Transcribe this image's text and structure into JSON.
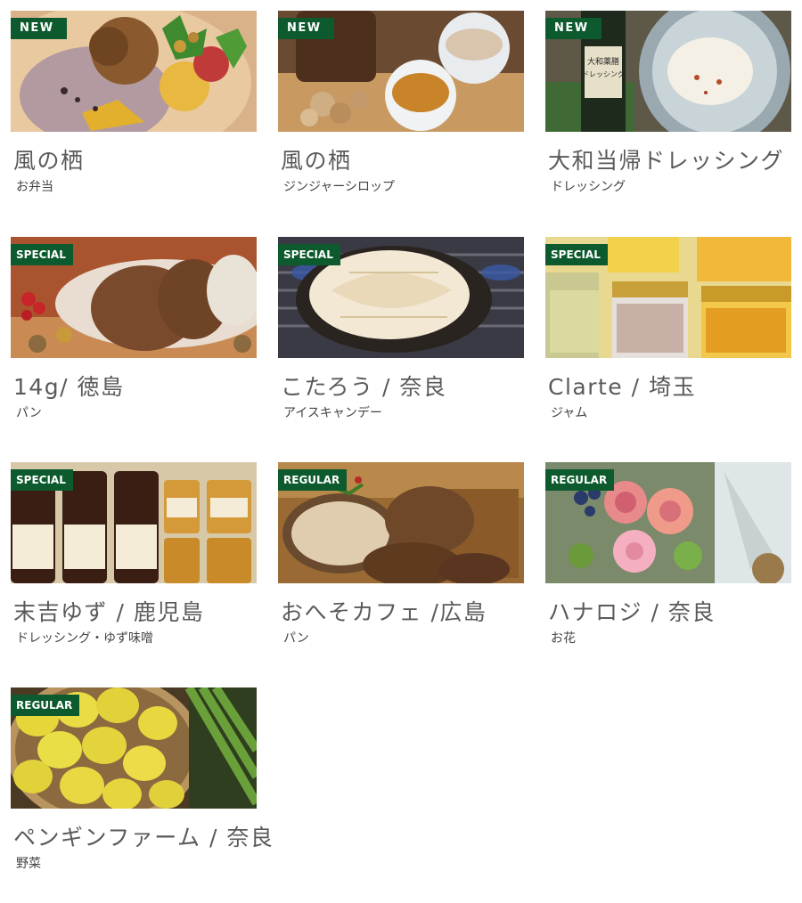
{
  "cards": [
    {
      "badge": "NEW",
      "title": "風の栖",
      "sub": "お弁当",
      "image": "bento-photo"
    },
    {
      "badge": "NEW",
      "title": "風の栖",
      "sub": "ジンジャーシロップ",
      "image": "ginger-syrup-photo"
    },
    {
      "badge": "NEW",
      "title": "大和当帰ドレッシング",
      "sub": "ドレッシング",
      "image": "dressing-photo",
      "label_text": "大和薬膳\nドレッシング"
    },
    {
      "badge": "SPECIAL",
      "title": "14g/ 徳島",
      "sub": "パン",
      "image": "stollen-photo"
    },
    {
      "badge": "SPECIAL",
      "title": "こたろう / 奈良",
      "sub": "アイスキャンデー",
      "image": "taiyaki-photo"
    },
    {
      "badge": "SPECIAL",
      "title": "Clarte / 埼玉",
      "sub": "ジャム",
      "image": "jam-photo"
    },
    {
      "badge": "SPECIAL",
      "title": "末吉ゆず / 鹿児島",
      "sub": "ドレッシング・ゆず味噌",
      "image": "yuzu-products-photo"
    },
    {
      "badge": "REGULAR",
      "title": "おへそカフェ /広島",
      "sub": "パン",
      "image": "bread-photo"
    },
    {
      "badge": "REGULAR",
      "title": "ハナロジ / 奈良",
      "sub": "お花",
      "image": "flowers-photo"
    },
    {
      "badge": "REGULAR",
      "title": "ペンギンファーム / 奈良",
      "sub": "野菜",
      "image": "lemons-photo"
    }
  ]
}
